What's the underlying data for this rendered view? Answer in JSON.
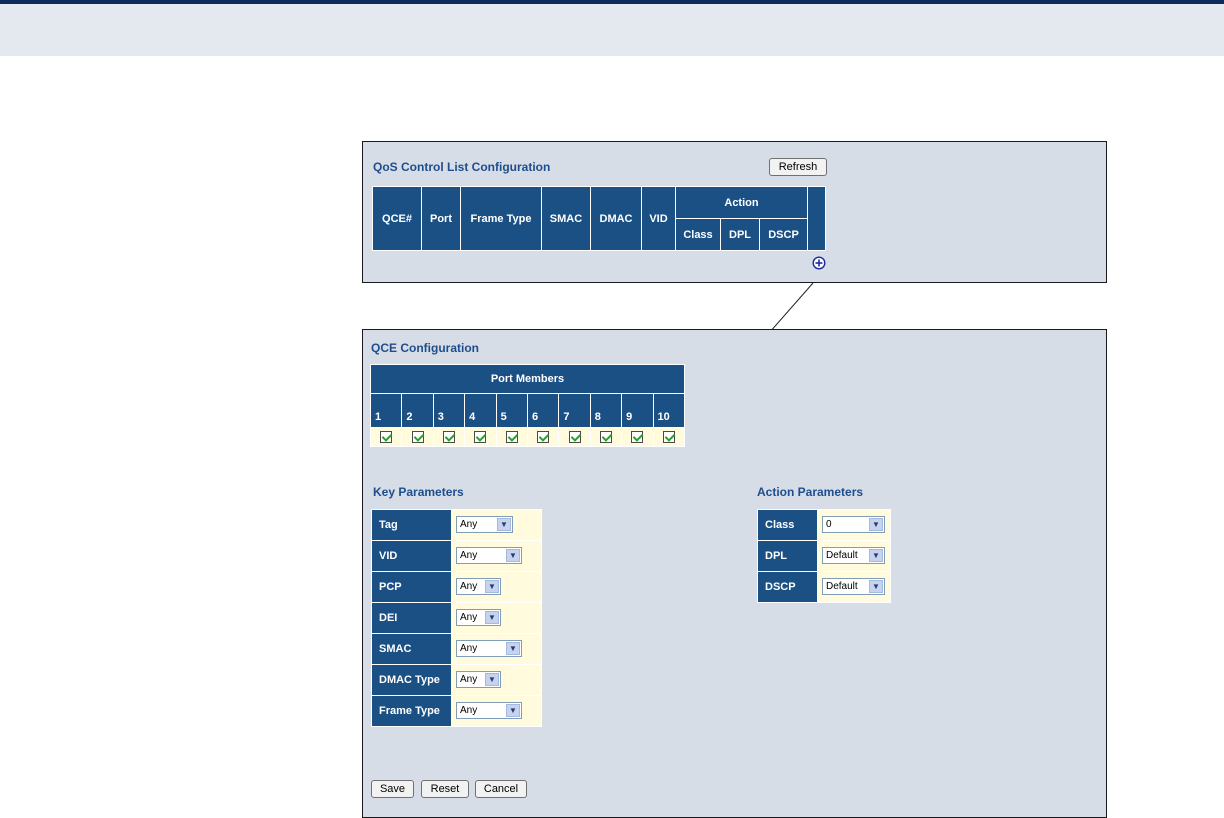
{
  "qcl": {
    "title": "QoS Control List Configuration",
    "refresh_label": "Refresh",
    "columns": [
      "QCE#",
      "Port",
      "Frame Type",
      "SMAC",
      "DMAC",
      "VID"
    ],
    "action_header": "Action",
    "action_columns": [
      "Class",
      "DPL",
      "DSCP"
    ]
  },
  "qce": {
    "title": "QCE Configuration",
    "port_members_header": "Port Members",
    "ports": [
      "1",
      "2",
      "3",
      "4",
      "5",
      "6",
      "7",
      "8",
      "9",
      "10"
    ],
    "key_params_title": "Key Parameters",
    "key_params": [
      {
        "label": "Tag",
        "value": "Any"
      },
      {
        "label": "VID",
        "value": "Any"
      },
      {
        "label": "PCP",
        "value": "Any"
      },
      {
        "label": "DEI",
        "value": "Any"
      },
      {
        "label": "SMAC",
        "value": "Any"
      },
      {
        "label": "DMAC Type",
        "value": "Any"
      },
      {
        "label": "Frame Type",
        "value": "Any"
      }
    ],
    "action_params_title": "Action Parameters",
    "action_params": [
      {
        "label": "Class",
        "value": "0"
      },
      {
        "label": "DPL",
        "value": "Default"
      },
      {
        "label": "DSCP",
        "value": "Default"
      }
    ],
    "save_label": "Save",
    "reset_label": "Reset",
    "cancel_label": "Cancel"
  },
  "colors": {
    "header_blue": "#1b5085",
    "panel_bg": "#d6dde7",
    "cell_bg": "#fffbdc",
    "title_blue": "#1f4e8c"
  }
}
